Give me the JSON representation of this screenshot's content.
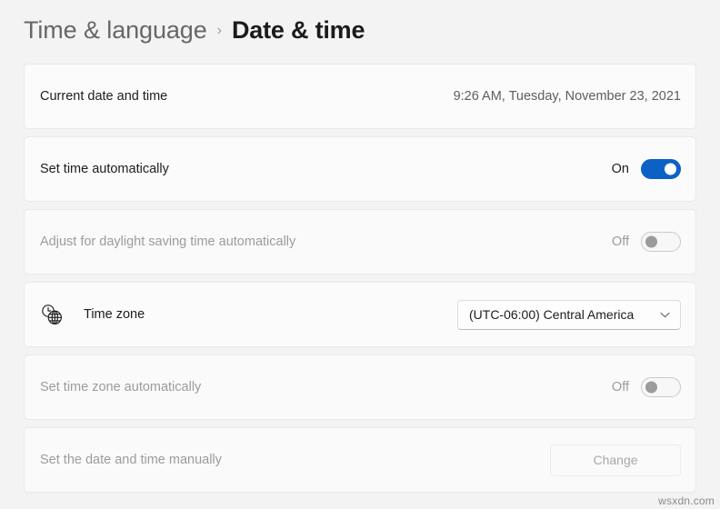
{
  "breadcrumb": {
    "parent": "Time & language",
    "separator": "›",
    "current": "Date & time"
  },
  "colors": {
    "accent": "#0b62c4",
    "page_background": "#f3f3f3",
    "card_background": "#fbfbfb",
    "card_border": "#e9e9e9",
    "text_primary": "#1d1d1d",
    "text_secondary": "#5e5e5e",
    "text_disabled": "#9c9c9c"
  },
  "rows": {
    "current_date_time": {
      "label": "Current date and time",
      "value": "9:26 AM, Tuesday, November 23, 2021"
    },
    "set_time_automatically": {
      "label": "Set time automatically",
      "state": "On"
    },
    "adjust_daylight_saving": {
      "label": "Adjust for daylight saving time automatically",
      "state": "Off"
    },
    "time_zone": {
      "label": "Time zone",
      "icon": "timezone-globe-clock-icon",
      "selected": "(UTC-06:00) Central America"
    },
    "set_time_zone_automatically": {
      "label": "Set time zone automatically",
      "state": "Off"
    },
    "set_date_time_manually": {
      "label": "Set the date and time manually",
      "button": "Change"
    }
  },
  "watermark": "wsxdn.com"
}
